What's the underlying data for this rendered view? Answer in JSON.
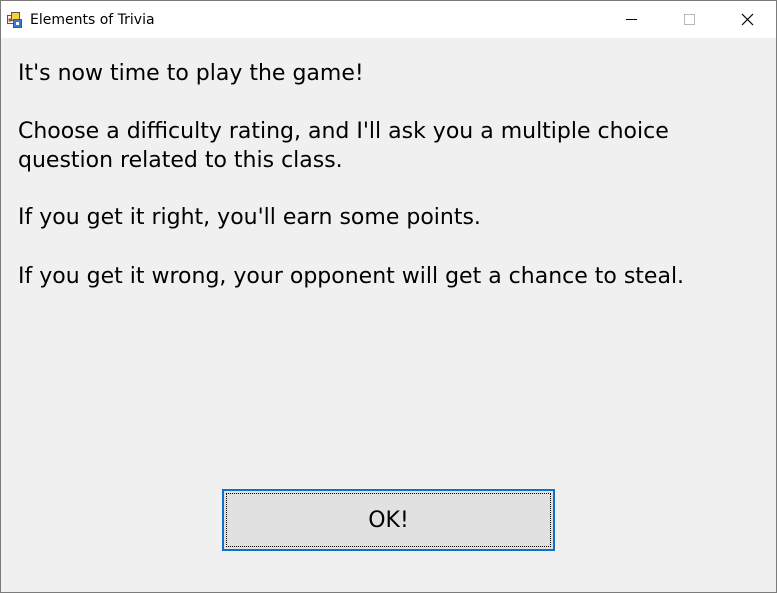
{
  "window": {
    "title": "Elements of Trivia",
    "controls": {
      "minimize_icon": "minimize-icon",
      "maximize_icon": "maximize-icon",
      "close_icon": "close-icon"
    }
  },
  "message": {
    "line1": "It's now time to play the game!",
    "line2a": "Choose a difficulty rating, and I'll ask you a multiple choice",
    "line2b": "question related to this class.",
    "line3": "If you get it right, you'll earn some points.",
    "line4": "If you get it wrong, your opponent will get a chance to steal."
  },
  "ok_button": {
    "label": "OK!"
  },
  "colors": {
    "background": "#f0f0f0",
    "titlebar": "#ffffff",
    "button_face": "#e1e1e1",
    "button_focus_border": "#0f6fcc"
  }
}
